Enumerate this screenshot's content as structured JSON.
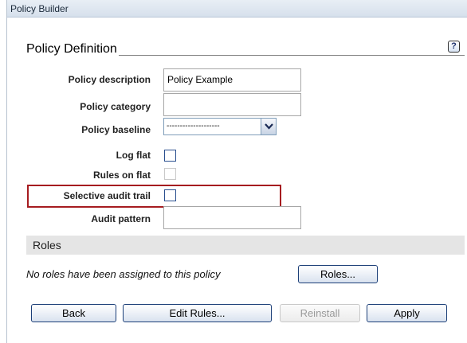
{
  "window": {
    "title": "Policy Builder"
  },
  "section": {
    "title": "Policy Definition",
    "help_label": "?"
  },
  "form": {
    "description": {
      "label": "Policy description",
      "value": "Policy Example"
    },
    "category": {
      "label": "Policy category",
      "value": ""
    },
    "baseline": {
      "label": "Policy baseline",
      "value": "--------------------"
    },
    "log_flat": {
      "label": "Log flat",
      "checked": false
    },
    "rules_on_flat": {
      "label": "Rules on flat",
      "checked": false,
      "disabled": true
    },
    "selective_audit_trail": {
      "label": "Selective audit trail",
      "checked": false
    },
    "audit_pattern": {
      "label": "Audit pattern",
      "value": ""
    }
  },
  "roles": {
    "header": "Roles",
    "message": "No roles have been assigned to this policy",
    "button_label": "Roles..."
  },
  "actions": {
    "back": "Back",
    "edit_rules": "Edit Rules...",
    "reinstall": "Reinstall",
    "apply": "Apply"
  },
  "colors": {
    "highlight_border": "#a61c20",
    "titlebar": "#d6e0ec",
    "button_border": "#1c3f78"
  }
}
